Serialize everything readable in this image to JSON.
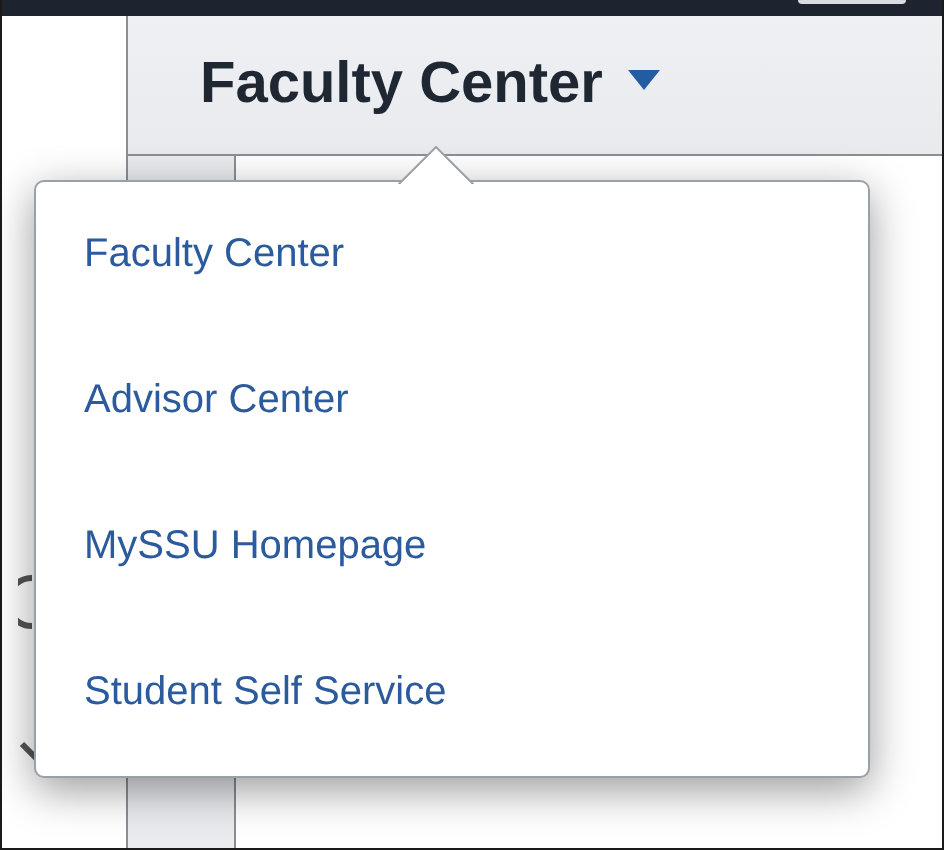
{
  "header": {
    "title": "Faculty Center"
  },
  "menu": {
    "items": [
      {
        "label": "Faculty Center"
      },
      {
        "label": "Advisor Center"
      },
      {
        "label": "MySSU Homepage"
      },
      {
        "label": "Student Self Service"
      }
    ]
  }
}
